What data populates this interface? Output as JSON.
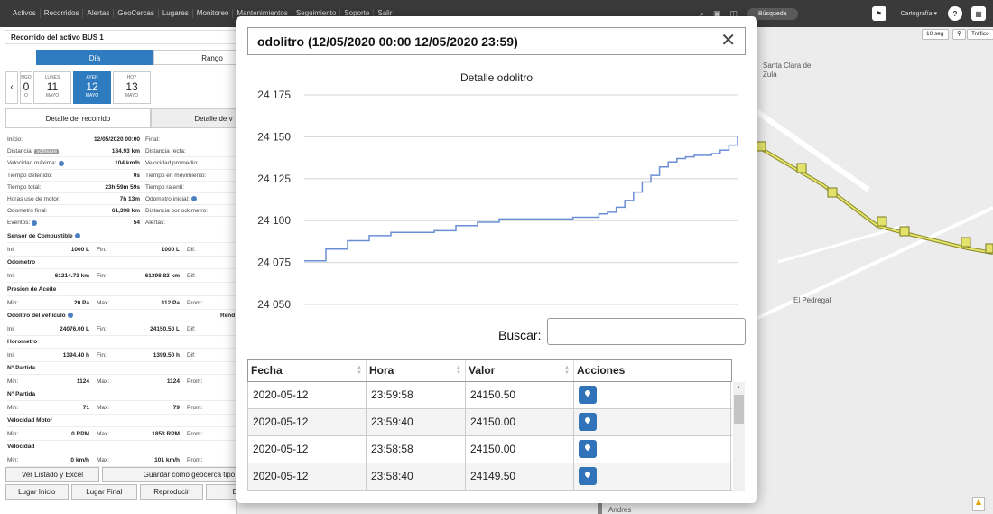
{
  "nav": {
    "links": [
      "Activos",
      "Recorridos",
      "Alertas",
      "GeoCercas",
      "Lugares",
      "Monitoreo",
      "Mantenimientos",
      "Seguimiento",
      "Soporte",
      "Salir"
    ],
    "search_label": "Búsqueda",
    "map_type": "Cartografía ▾",
    "help": "?"
  },
  "left": {
    "title": "Recorrido del activo BUS 1",
    "mode_day": "Día",
    "mode_range": "Rango",
    "days": [
      {
        "name": "LUNES",
        "num": "11",
        "month": "MAYO"
      },
      {
        "name": "AYER",
        "num": "12",
        "month": "MAYO"
      },
      {
        "name": "HOY",
        "num": "13",
        "month": "MAYO"
      }
    ],
    "partial_day": {
      "name": "NGO",
      "num": "0",
      "month": "O"
    },
    "tab_detail": "Detalle del recorrido",
    "tab_detail2": "Detalle de v",
    "rows": [
      {
        "l": "Inicio:",
        "v": "12/05/2020 00:00",
        "r": "Final:"
      },
      {
        "l": "Distancia:",
        "v": "184.93 km",
        "r": "Distancia recta:",
        "badge": "software"
      },
      {
        "l": "Velocidad máxima:",
        "v": "104 km/h",
        "r": "Velocidad promedio:"
      },
      {
        "l": "Tiempo detenido:",
        "v": "0s",
        "r": "Tiempo en movimiento:"
      },
      {
        "l": "Tiempo total:",
        "v": "23h 59m 59s",
        "r": "Tiempo ralentí:"
      },
      {
        "l": "Horas uso de motor:",
        "v": "7h 13m",
        "r": "Odometro inicial:"
      },
      {
        "l": "Odometro final:",
        "v": "61,398 km",
        "r": "Distancia por odometro:"
      },
      {
        "l": "Eventos:",
        "v": "54",
        "r": "Alertas:"
      }
    ],
    "sections": [
      {
        "title": "Sensor de Combustible",
        "a": "Ini:",
        "b": "1000 L",
        "c": "Fin:",
        "d": "1000 L",
        "e": "Dif:"
      },
      {
        "title": "Odometro",
        "a": "Ini:",
        "b": "61214.73 km",
        "c": "Fin:",
        "d": "61398.83 km",
        "e": "Dif:"
      },
      {
        "title": "Presion de Aceite",
        "a": "Min:",
        "b": "20 Pa",
        "c": "Max:",
        "d": "312 Pa",
        "e": "Prom:"
      },
      {
        "title": "Odolitro del vehiculo",
        "a": "Ini:",
        "b": "24076.00 L",
        "c": "Fin:",
        "d": "24150.50 L",
        "e": "Dif:",
        "extra": "Rend"
      },
      {
        "title": "Horometro",
        "a": "Ini:",
        "b": "1394.40 h",
        "c": "Fin:",
        "d": "1399.50 h",
        "e": "Dif:"
      },
      {
        "title": "N° Partida",
        "a": "Min:",
        "b": "1124",
        "c": "Max:",
        "d": "1124",
        "e": "Prom:"
      },
      {
        "title": "N° Partida",
        "a": "Min:",
        "b": "71",
        "c": "Max:",
        "d": "79",
        "e": "Prom:"
      },
      {
        "title": "Velocidad Motor",
        "a": "Min:",
        "b": "0 RPM",
        "c": "Max:",
        "d": "1853 RPM",
        "e": "Prom:"
      },
      {
        "title": "Velocidad",
        "a": "Min:",
        "b": "0 km/h",
        "c": "Max:",
        "d": "101 km/h",
        "e": "Prom:"
      }
    ],
    "btn_list": "Ver Listado y Excel",
    "btn_geofence": "Guardar como geocerca tipo",
    "btn_start": "Lugar Inicio",
    "btn_end": "Lugar Final",
    "btn_play": "Reproducir",
    "btn_export": "Expo"
  },
  "map": {
    "interval": "10 seg",
    "traffic": "Tráfico",
    "labels": [
      "Santa Clara de Zula",
      "El Pedregal",
      "Andrés"
    ]
  },
  "modal": {
    "title": "odolitro (12/05/2020 00:00 12/05/2020 23:59)",
    "close": "✕",
    "search_label": "Buscar:",
    "search_value": "",
    "columns": [
      "Fecha",
      "Hora",
      "Valor",
      "Acciones"
    ],
    "rows": [
      {
        "fecha": "2020-05-12",
        "hora": "23:59:58",
        "valor": "24150.50"
      },
      {
        "fecha": "2020-05-12",
        "hora": "23:59:40",
        "valor": "24150.00"
      },
      {
        "fecha": "2020-05-12",
        "hora": "23:58:58",
        "valor": "24150.00"
      },
      {
        "fecha": "2020-05-12",
        "hora": "23:58:40",
        "valor": "24149.50"
      }
    ]
  },
  "chart_data": {
    "type": "line",
    "title": "Detalle odolitro",
    "ylim": [
      24050,
      24175
    ],
    "yticks": [
      "24 050",
      "24 075",
      "24 100",
      "24 125",
      "24 150",
      "24 175"
    ],
    "series": [
      {
        "color": "#6a8fd6",
        "x": [
          0,
          0.05,
          0.1,
          0.15,
          0.2,
          0.25,
          0.3,
          0.35,
          0.4,
          0.45,
          0.5,
          0.55,
          0.6,
          0.62,
          0.65,
          0.68,
          0.7,
          0.72,
          0.74,
          0.76,
          0.78,
          0.8,
          0.82,
          0.84,
          0.86,
          0.88,
          0.9,
          0.92,
          0.94,
          0.96,
          0.98,
          1.0
        ],
        "y": [
          24076,
          24083,
          24088,
          24091,
          24093,
          24093,
          24094,
          24097,
          24099,
          24101,
          24101,
          24101,
          24101,
          24102,
          24102,
          24104,
          24105,
          24108,
          24112,
          24117,
          24123,
          24127,
          24132,
          24135,
          24137,
          24138,
          24139,
          24139,
          24140,
          24142,
          24145,
          24150.5
        ]
      }
    ]
  }
}
